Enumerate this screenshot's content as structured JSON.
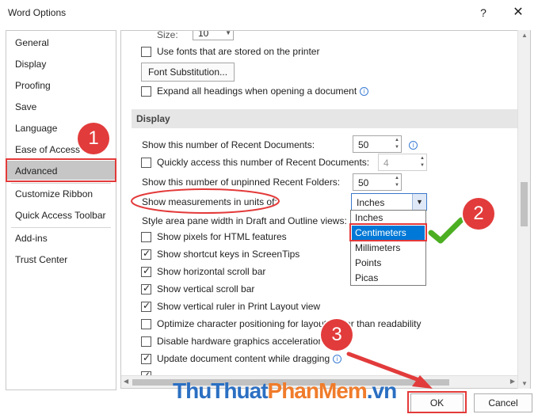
{
  "window": {
    "title": "Word Options",
    "help_glyph": "?",
    "close_glyph": "✕"
  },
  "sidebar": {
    "items": [
      {
        "label": "General"
      },
      {
        "label": "Display"
      },
      {
        "label": "Proofing"
      },
      {
        "label": "Save"
      },
      {
        "label": "Language"
      },
      {
        "label": "Ease of Access"
      },
      {
        "label": "Advanced",
        "selected": true
      },
      {
        "label": "Customize Ribbon"
      },
      {
        "label": "Quick Access Toolbar"
      },
      {
        "label": "Add-ins"
      },
      {
        "label": "Trust Center"
      }
    ]
  },
  "content": {
    "size_label": "Size:",
    "size_value": "10",
    "use_printer_fonts": {
      "label": "Use fonts that are stored on the printer",
      "checked": false
    },
    "font_substitution_button": "Font Substitution...",
    "expand_headings": {
      "label": "Expand all headings when opening a document",
      "checked": false
    },
    "display_section": {
      "title": "Display"
    },
    "recent_docs": {
      "label": "Show this number of Recent Documents:",
      "value": "50"
    },
    "quick_access": {
      "label": "Quickly access this number of Recent Documents:",
      "value": "4",
      "checked": false
    },
    "recent_folders": {
      "label": "Show this number of unpinned Recent Folders:",
      "value": "50"
    },
    "measurements": {
      "label": "Show measurements in units of:",
      "selected": "Inches",
      "options": [
        "Inches",
        "Centimeters",
        "Millimeters",
        "Points",
        "Picas"
      ],
      "highlighted": "Centimeters"
    },
    "style_area": {
      "label": "Style area pane width in Draft and Outline views:"
    },
    "checkboxes": [
      {
        "label": "Show pixels for HTML features",
        "checked": false
      },
      {
        "label": "Show shortcut keys in ScreenTips",
        "checked": true
      },
      {
        "label": "Show horizontal scroll bar",
        "checked": true
      },
      {
        "label": "Show vertical scroll bar",
        "checked": true
      },
      {
        "label": "Show vertical ruler in Print Layout view",
        "checked": true
      },
      {
        "label": "Optimize character positioning for layout rather than readability",
        "checked": false
      },
      {
        "label": "Disable hardware graphics acceleration",
        "checked": false
      },
      {
        "label": "Update document content while dragging",
        "checked": true
      }
    ]
  },
  "footer": {
    "ok_label": "OK",
    "cancel_label": "Cancel"
  },
  "annotations": {
    "step1": "1",
    "step2": "2",
    "step3": "3",
    "accent_color": "#e23b3b",
    "check_color": "#4caf22"
  },
  "watermark": {
    "part1": "ThuThuat",
    "part2": "PhanMem",
    "part3": ".vn"
  }
}
